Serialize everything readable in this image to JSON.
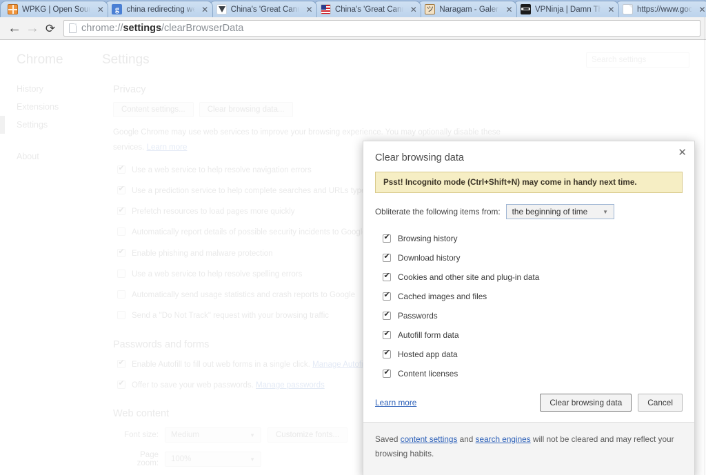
{
  "browser": {
    "tabs": [
      {
        "title": "WPKG | Open Source",
        "favicon": "grid-orange-icon",
        "favclass": "fav-wpkg",
        "glyph": "",
        "active": false
      },
      {
        "title": "china redirecting web",
        "favicon": "google-g-icon",
        "favclass": "fav-google",
        "glyph": "g",
        "active": false
      },
      {
        "title": "China's 'Great Canno",
        "favicon": "shield-icon",
        "favclass": "fav-shield",
        "glyph": "",
        "active": false
      },
      {
        "title": "China's 'Great Canno",
        "favicon": "us-flag-icon",
        "favclass": "fav-flag",
        "glyph": "",
        "active": false
      },
      {
        "title": "Naragam - Galerie",
        "favicon": "naragam-icon",
        "favclass": "fav-naragam",
        "glyph": "",
        "active": false
      },
      {
        "title": "VPNinja | Damn The",
        "favicon": "ninja-icon",
        "favclass": "fav-ninja",
        "glyph": "",
        "active": false
      },
      {
        "title": "https://www.goog",
        "favicon": "page-icon",
        "favclass": "fav-page",
        "glyph": "",
        "active": false
      }
    ],
    "tab_close_label": "✕",
    "nav": {
      "back_label": "←",
      "forward_label": "→",
      "reload_label": "⟳"
    },
    "omnibox": {
      "scheme": "chrome://",
      "host": "settings",
      "path": "/clearBrowserData",
      "full_url": "chrome://settings/clearBrowserData"
    }
  },
  "settings": {
    "sidebar": {
      "brand": "Chrome",
      "items": [
        {
          "label": "History",
          "selected": false
        },
        {
          "label": "Extensions",
          "selected": false
        },
        {
          "label": "Settings",
          "selected": true
        },
        {
          "label": "About",
          "selected": false
        }
      ]
    },
    "page_title": "Settings",
    "search": {
      "placeholder": "Search settings",
      "value": ""
    },
    "privacy": {
      "heading": "Privacy",
      "buttons": [
        "Content settings...",
        "Clear browsing data..."
      ],
      "description_prefix": "Google Chrome may use web services to improve your browsing experience. You may optionally disable these services. ",
      "description_link": "Learn more",
      "options": [
        {
          "label": "Use a web service to help resolve navigation errors",
          "checked": true
        },
        {
          "label": "Use a prediction service to help complete searches and URLs typed in the address bar or the app launcher search box",
          "checked": true
        },
        {
          "label": "Prefetch resources to load pages more quickly",
          "checked": true
        },
        {
          "label": "Automatically report details of possible security incidents to Google",
          "checked": false
        },
        {
          "label": "Enable phishing and malware protection",
          "checked": true
        },
        {
          "label": "Use a web service to help resolve spelling errors",
          "checked": false
        },
        {
          "label": "Automatically send usage statistics and crash reports to Google",
          "checked": false
        },
        {
          "label": "Send a \"Do Not Track\" request with your browsing traffic",
          "checked": false
        }
      ]
    },
    "passwords_and_forms": {
      "heading": "Passwords and forms",
      "options": [
        {
          "label": "Enable Autofill to fill out web forms in a single click.",
          "link": "Manage Autofill settings",
          "checked": true
        },
        {
          "label": "Offer to save your web passwords.",
          "link": "Manage passwords",
          "checked": true
        }
      ]
    },
    "web_content": {
      "heading": "Web content",
      "font_size_label": "Font size:",
      "font_size_value": "Medium",
      "customize_fonts_button": "Customize fonts...",
      "page_zoom_label": "Page zoom:",
      "page_zoom_value": "100%",
      "caret": "▼"
    }
  },
  "dialog": {
    "title": "Clear browsing data",
    "close_label": "✕",
    "banner": "Psst! Incognito mode (Ctrl+Shift+N) may come in handy next time.",
    "from_label": "Obliterate the following items from:",
    "from_value": "the beginning of time",
    "from_caret": "▼",
    "checkmark": "✔",
    "items": [
      {
        "label": "Browsing history",
        "checked": true
      },
      {
        "label": "Download history",
        "checked": true
      },
      {
        "label": "Cookies and other site and plug-in data",
        "checked": true
      },
      {
        "label": "Cached images and files",
        "checked": true
      },
      {
        "label": "Passwords",
        "checked": true
      },
      {
        "label": "Autofill form data",
        "checked": true
      },
      {
        "label": "Hosted app data",
        "checked": true
      },
      {
        "label": "Content licenses",
        "checked": true
      }
    ],
    "learn_more": "Learn more",
    "confirm_button": "Clear browsing data",
    "cancel_button": "Cancel",
    "footer": {
      "prefix": "Saved ",
      "link1": "content settings",
      "middle": " and ",
      "link2": "search engines",
      "suffix": " will not be cleared and may reflect your browsing habits."
    }
  },
  "colors": {
    "tab_strip": "#8fb0d6",
    "toolbar": "#f2f2f2",
    "banner_bg": "#f6eec4",
    "banner_border": "#d8c98a",
    "link": "#2b5fb8",
    "dialog_footer": "#f4f4f4"
  }
}
